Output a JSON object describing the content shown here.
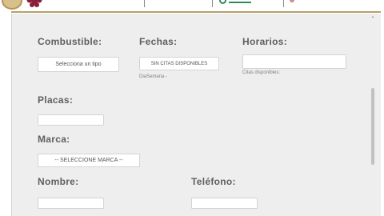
{
  "form": {
    "combustible": {
      "label": "Combustible:",
      "select_value": "Selecciona un tipo"
    },
    "fechas": {
      "label": "Fechas:",
      "select_value": "SIN CITAS DISPONIBLES",
      "helper": "DiaSemana -"
    },
    "horarios": {
      "label": "Horarios:",
      "select_value": "",
      "helper": "Citas disponibles:"
    },
    "placas": {
      "label": "Placas:",
      "value": ""
    },
    "marca": {
      "label": "Marca:",
      "select_value": "-- SELECCIONE MARCA --"
    },
    "nombre": {
      "label": "Nombre:",
      "value": ""
    },
    "telefono": {
      "label": "Teléfono:",
      "value": ""
    }
  },
  "colors": {
    "panel_bg": "#eeeeee",
    "label_text": "#5f5f5f",
    "accent_gold": "#b8a06a",
    "accent_green": "#2e8b57"
  },
  "icons": [
    "seal-logo-icon",
    "flower-logo-icon",
    "scroll-up-arrow-icon"
  ]
}
